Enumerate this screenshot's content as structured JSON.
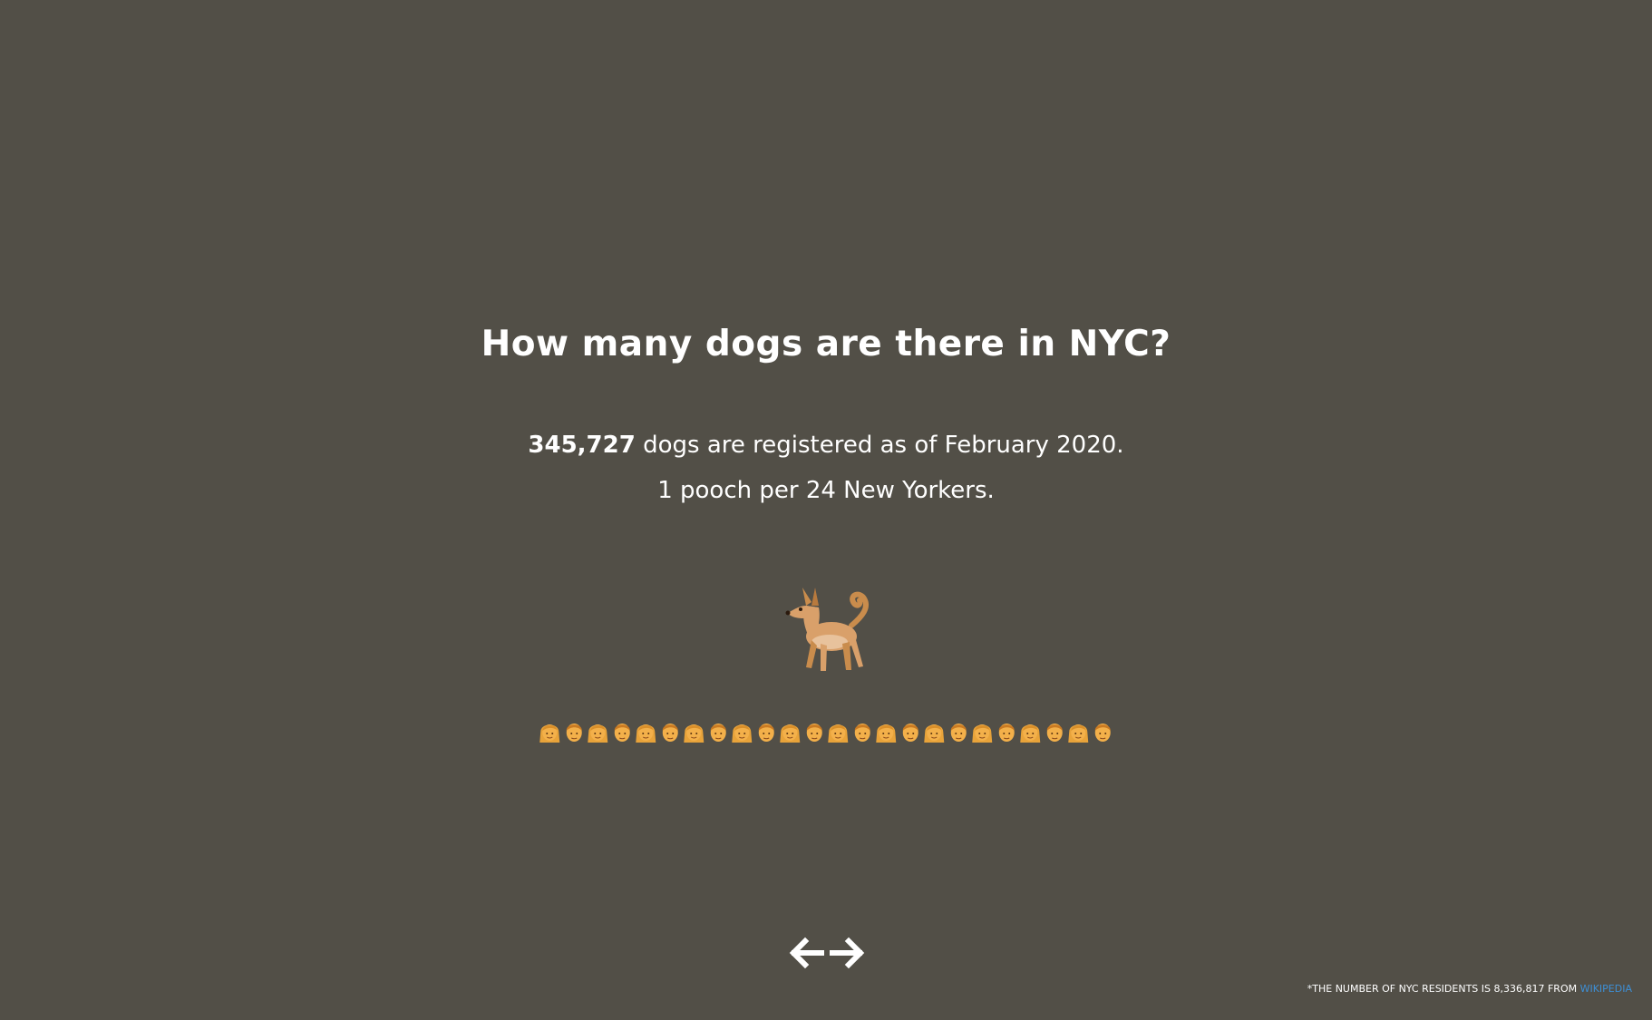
{
  "title": "How many dogs are there in NYC?",
  "stats": {
    "count": "345,727",
    "count_suffix": " dogs are registered as of February 2020.",
    "ratio": "1 pooch per 24 New Yorkers."
  },
  "visual": {
    "dog_icon": "dog-icon",
    "people_count": 24,
    "people_pattern": [
      "woman-icon",
      "man-icon"
    ]
  },
  "nav": {
    "prev_icon": "arrow-left-icon",
    "next_icon": "arrow-right-icon"
  },
  "footnote": {
    "text": "*THE NUMBER OF NYC RESIDENTS IS 8,336,817 FROM ",
    "link_label": "WIKIPEDIA"
  },
  "colors": {
    "background": "#524f47",
    "text": "#ffffff",
    "link": "#3d8fd6"
  }
}
